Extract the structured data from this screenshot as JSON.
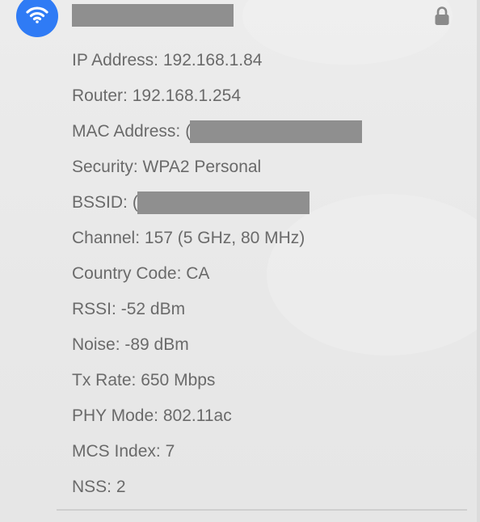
{
  "header": {
    "wifi_icon": "wifi-icon",
    "lock_icon": "lock-icon",
    "accent_color": "#2f7bf5"
  },
  "details": {
    "ip": {
      "label": "IP Address:",
      "value": "192.168.1.84"
    },
    "router": {
      "label": "Router:",
      "value": "192.168.1.254"
    },
    "mac": {
      "label": "MAC Address:",
      "value_fragment": "("
    },
    "security": {
      "label": "Security:",
      "value": "WPA2 Personal"
    },
    "bssid": {
      "label": "BSSID:",
      "value_fragment": "("
    },
    "channel": {
      "label": "Channel:",
      "value": "157 (5 GHz, 80 MHz)"
    },
    "country": {
      "label": "Country Code:",
      "value": "CA"
    },
    "rssi": {
      "label": "RSSI:",
      "value": "-52 dBm"
    },
    "noise": {
      "label": "Noise:",
      "value": "-89 dBm"
    },
    "tx_rate": {
      "label": "Tx Rate:",
      "value": "650 Mbps"
    },
    "phy": {
      "label": "PHY Mode:",
      "value": "802.11ac"
    },
    "mcs": {
      "label": "MCS Index:",
      "value": "7"
    },
    "nss": {
      "label": "NSS:",
      "value": "2"
    }
  }
}
